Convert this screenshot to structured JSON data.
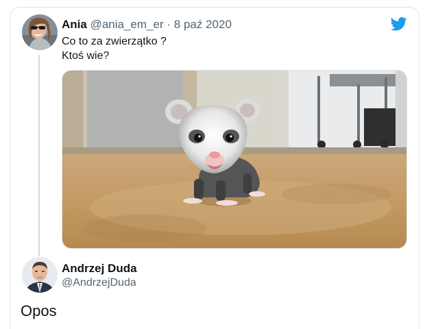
{
  "tweet": {
    "author_name": "Ania",
    "author_handle": "@ania_em_er",
    "separator": "·",
    "date": "8 paź 2020",
    "text_line1": "Co to za zwierzątko ?",
    "text_line2": "Ktoś wie?",
    "media_icon": "opossum-photo"
  },
  "reply": {
    "author_name": "Andrzej Duda",
    "author_handle": "@AndrzejDuda",
    "text": "Opos"
  },
  "icons": {
    "brand": "twitter-bird-icon",
    "brand_color": "#1d9bf0"
  },
  "colors": {
    "secondary_text": "#536471",
    "border": "#dfe3e6",
    "thread_line": "#cfd9de"
  }
}
